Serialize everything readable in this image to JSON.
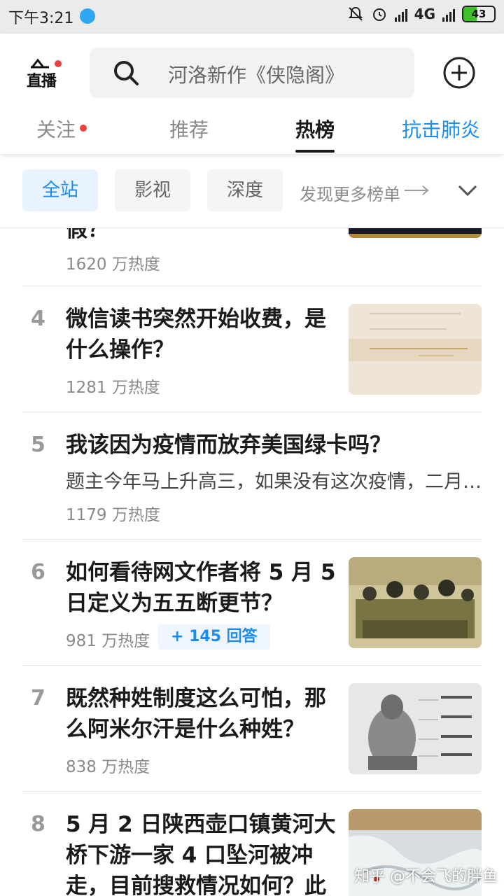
{
  "status_bar": {
    "time": "下午3:21",
    "network": "4G",
    "battery": "43",
    "battery_level": 0.43
  },
  "header": {
    "live_label": "直播",
    "search_placeholder": "河洛新作《侠隐阁》",
    "tabs": [
      {
        "label": "关注",
        "dot": true
      },
      {
        "label": "推荐"
      },
      {
        "label": "热榜",
        "active": true
      },
      {
        "label": "抗击肺炎",
        "highlight": true
      }
    ]
  },
  "filters": {
    "chips": [
      "全站",
      "影视",
      "深度"
    ],
    "active_chip": "全站",
    "more_label": "发现更多榜单"
  },
  "list": {
    "items": [
      {
        "rank": "",
        "title_lines": [
          "假？"
        ],
        "heat": "1620 万热度",
        "thumbnail": "profile-stats-card"
      },
      {
        "rank": "4",
        "title_lines": [
          "微信读书突然开始收费，是",
          "什么操作？"
        ],
        "heat": "1281 万热度",
        "thumbnail": "book-page"
      },
      {
        "rank": "5",
        "title_lines": [
          "我该因为疫情而放弃美国绿卡吗？"
        ],
        "excerpt": "题主今年马上升高三，如果没有这次疫情，二月…",
        "heat": "1179 万热度"
      },
      {
        "rank": "6",
        "title_lines": [
          "如何看待网文作者将 5 月 5",
          "日定义为五五断更节？"
        ],
        "heat": "981 万热度",
        "badge": "+ 145 回答",
        "thumbnail": "cartoon-illustration"
      },
      {
        "rank": "7",
        "title_lines": [
          "既然种姓制度这么可怕，那",
          "么阿米尔汗是什么种姓？"
        ],
        "heat": "838 万热度",
        "thumbnail": "caste-diagram"
      },
      {
        "rank": "8",
        "title_lines": [
          "5 月 2 日陕西壶口镇黄河大",
          "桥下游一家 4 口坠河被冲",
          "走，目前搜救情况如何？此"
        ],
        "thumbnail": "frozen-waterfall"
      }
    ]
  },
  "watermark": "知乎 @不会飞的胖鱼",
  "colors": {
    "accent_blue": "#1a8cf0",
    "dot_red": "#f1403c",
    "battery_green": "#3fbf2b"
  }
}
